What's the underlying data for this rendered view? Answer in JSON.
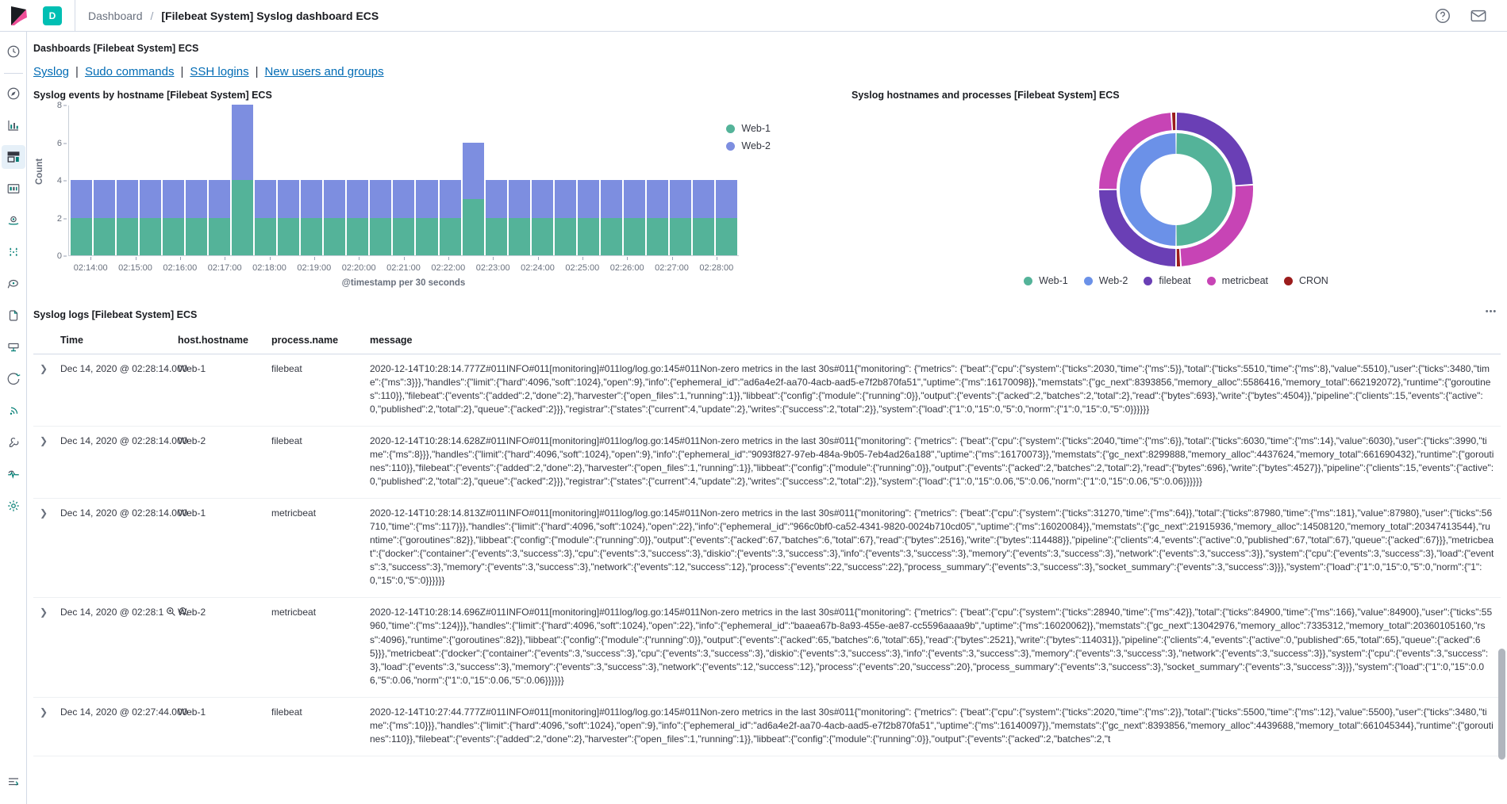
{
  "topbar": {
    "space_badge": "D",
    "breadcrumb_parent": "Dashboard",
    "breadcrumb_sep": "/",
    "breadcrumb_current": "[Filebeat System] Syslog dashboard ECS",
    "help_icon": "help-circle-icon",
    "mail_icon": "mail-icon",
    "logo_icon": "kibana-logo-icon"
  },
  "rail": {
    "items": [
      {
        "name": "recently-viewed",
        "icon": "clock-icon",
        "selected": false
      },
      {
        "name": "discover",
        "icon": "compass-icon",
        "selected": false
      },
      {
        "name": "visualize",
        "icon": "bar-chart-icon",
        "selected": false
      },
      {
        "name": "dashboard",
        "icon": "dashboard-icon",
        "selected": true
      },
      {
        "name": "canvas",
        "icon": "canvas-icon",
        "selected": false
      },
      {
        "name": "maps",
        "icon": "map-marker-icon",
        "selected": false
      },
      {
        "name": "machine-learning",
        "icon": "ml-nodes-icon",
        "selected": false
      },
      {
        "name": "infrastructure",
        "icon": "metrics-icon",
        "selected": false
      },
      {
        "name": "logs",
        "icon": "logs-icon",
        "selected": false
      },
      {
        "name": "apm",
        "icon": "apm-icon",
        "selected": false
      },
      {
        "name": "uptime",
        "icon": "uptime-icon",
        "selected": false
      },
      {
        "name": "siem",
        "icon": "security-icon",
        "selected": false
      },
      {
        "name": "dev-tools",
        "icon": "wrench-icon",
        "selected": false
      },
      {
        "name": "monitoring",
        "icon": "heartbeat-icon",
        "selected": false
      },
      {
        "name": "management",
        "icon": "gear-icon",
        "selected": false
      }
    ],
    "bottom_icon": "collapse-icon"
  },
  "dashboard": {
    "header": "Dashboards [Filebeat System] ECS",
    "nav_links": [
      "Syslog",
      "Sudo commands",
      "SSH logins",
      "New users and groups"
    ],
    "nav_separator": "|"
  },
  "chart_data": [
    {
      "type": "bar",
      "title": "Syslog events by hostname [Filebeat System] ECS",
      "stacked": true,
      "xlabel": "@timestamp per 30 seconds",
      "ylabel": "Count",
      "ylim": [
        0,
        8
      ],
      "yticks": [
        0,
        2,
        4,
        6,
        8
      ],
      "xticks": [
        "02:14:00",
        "02:15:00",
        "02:16:00",
        "02:17:00",
        "02:18:00",
        "02:19:00",
        "02:20:00",
        "02:21:00",
        "02:22:00",
        "02:23:00",
        "02:24:00",
        "02:25:00",
        "02:26:00",
        "02:27:00",
        "02:28:00"
      ],
      "grid": false,
      "legend_position": "right",
      "series": [
        {
          "name": "Web-1",
          "color": "#54b399",
          "values": [
            2,
            2,
            2,
            2,
            2,
            2,
            2,
            4,
            2,
            2,
            2,
            2,
            2,
            2,
            2,
            2,
            2,
            3,
            2,
            2,
            2,
            2,
            2,
            2,
            2,
            2,
            2,
            2,
            2
          ]
        },
        {
          "name": "Web-2",
          "color": "#7d8ee0",
          "values": [
            2,
            2,
            2,
            2,
            2,
            2,
            2,
            4,
            2,
            2,
            2,
            2,
            2,
            2,
            2,
            2,
            2,
            3,
            2,
            2,
            2,
            2,
            2,
            2,
            2,
            2,
            2,
            2,
            2
          ]
        }
      ]
    },
    {
      "type": "pie",
      "title": "Syslog hostnames and processes [Filebeat System] ECS",
      "legend_position": "bottom",
      "rings": [
        {
          "name": "hostname",
          "slices": [
            {
              "label": "Web-1",
              "value": 50,
              "color": "#54b399"
            },
            {
              "label": "Web-2",
              "value": 50,
              "color": "#6b91e8"
            }
          ]
        },
        {
          "name": "process",
          "slices": [
            {
              "label": "filebeat",
              "value": 24,
              "color": "#6a3fb5"
            },
            {
              "label": "metricbeat",
              "value": 25,
              "color": "#c744b5"
            },
            {
              "label": "CRON",
              "value": 1,
              "color": "#9b1c1c"
            },
            {
              "label": "filebeat",
              "value": 25,
              "color": "#6a3fb5"
            },
            {
              "label": "metricbeat",
              "value": 24,
              "color": "#c744b5"
            },
            {
              "label": "CRON",
              "value": 1,
              "color": "#9b1c1c"
            }
          ]
        }
      ],
      "legend": [
        {
          "label": "Web-1",
          "color": "#54b399"
        },
        {
          "label": "Web-2",
          "color": "#6b91e8"
        },
        {
          "label": "filebeat",
          "color": "#6a3fb5"
        },
        {
          "label": "metricbeat",
          "color": "#c744b5"
        },
        {
          "label": "CRON",
          "color": "#9b1c1c"
        }
      ]
    }
  ],
  "logs_panel": {
    "title": "Syslog logs [Filebeat System] ECS",
    "menu_icon": "panel-options-icon",
    "columns": [
      "Time",
      "host.hostname",
      "process.name",
      "message"
    ],
    "rows": [
      {
        "time": "Dec 14, 2020 @ 02:28:14.000",
        "host": "Web-1",
        "process": "filebeat",
        "message": "2020-12-14T10:28:14.777Z#011INFO#011[monitoring]#011log/log.go:145#011Non-zero metrics in the last 30s#011{\"monitoring\": {\"metrics\": {\"beat\":{\"cpu\":{\"system\":{\"ticks\":2030,\"time\":{\"ms\":5}},\"total\":{\"ticks\":5510,\"time\":{\"ms\":8},\"value\":5510},\"user\":{\"ticks\":3480,\"time\":{\"ms\":3}}},\"handles\":{\"limit\":{\"hard\":4096,\"soft\":1024},\"open\":9},\"info\":{\"ephemeral_id\":\"ad6a4e2f-aa70-4acb-aad5-e7f2b870fa51\",\"uptime\":{\"ms\":16170098}},\"memstats\":{\"gc_next\":8393856,\"memory_alloc\":5586416,\"memory_total\":662192072},\"runtime\":{\"goroutines\":110}},\"filebeat\":{\"events\":{\"added\":2,\"done\":2},\"harvester\":{\"open_files\":1,\"running\":1}},\"libbeat\":{\"config\":{\"module\":{\"running\":0}},\"output\":{\"events\":{\"acked\":2,\"batches\":2,\"total\":2},\"read\":{\"bytes\":693},\"write\":{\"bytes\":4504}},\"pipeline\":{\"clients\":15,\"events\":{\"active\":0,\"published\":2,\"total\":2},\"queue\":{\"acked\":2}}},\"registrar\":{\"states\":{\"current\":4,\"update\":2},\"writes\":{\"success\":2,\"total\":2}},\"system\":{\"load\":{\"1\":0,\"15\":0,\"5\":0,\"norm\":{\"1\":0,\"15\":0,\"5\":0}}}}}}",
        "has_filter_icons": false
      },
      {
        "time": "Dec 14, 2020 @ 02:28:14.000",
        "host": "Web-2",
        "process": "filebeat",
        "message": "2020-12-14T10:28:14.628Z#011INFO#011[monitoring]#011log/log.go:145#011Non-zero metrics in the last 30s#011{\"monitoring\": {\"metrics\": {\"beat\":{\"cpu\":{\"system\":{\"ticks\":2040,\"time\":{\"ms\":6}},\"total\":{\"ticks\":6030,\"time\":{\"ms\":14},\"value\":6030},\"user\":{\"ticks\":3990,\"time\":{\"ms\":8}}},\"handles\":{\"limit\":{\"hard\":4096,\"soft\":1024},\"open\":9},\"info\":{\"ephemeral_id\":\"9093f827-97eb-484a-9b05-7eb4ad26a188\",\"uptime\":{\"ms\":16170073}},\"memstats\":{\"gc_next\":8299888,\"memory_alloc\":4437624,\"memory_total\":661690432},\"runtime\":{\"goroutines\":110}},\"filebeat\":{\"events\":{\"added\":2,\"done\":2},\"harvester\":{\"open_files\":1,\"running\":1}},\"libbeat\":{\"config\":{\"module\":{\"running\":0}},\"output\":{\"events\":{\"acked\":2,\"batches\":2,\"total\":2},\"read\":{\"bytes\":696},\"write\":{\"bytes\":4527}},\"pipeline\":{\"clients\":15,\"events\":{\"active\":0,\"published\":2,\"total\":2},\"queue\":{\"acked\":2}}},\"registrar\":{\"states\":{\"current\":4,\"update\":2},\"writes\":{\"success\":2,\"total\":2}},\"system\":{\"load\":{\"1\":0,\"15\":0.06,\"5\":0.06,\"norm\":{\"1\":0,\"15\":0.06,\"5\":0.06}}}}}}",
        "has_filter_icons": false
      },
      {
        "time": "Dec 14, 2020 @ 02:28:14.000",
        "host": "Web-1",
        "process": "metricbeat",
        "message": "2020-12-14T10:28:14.813Z#011INFO#011[monitoring]#011log/log.go:145#011Non-zero metrics in the last 30s#011{\"monitoring\": {\"metrics\": {\"beat\":{\"cpu\":{\"system\":{\"ticks\":31270,\"time\":{\"ms\":64}},\"total\":{\"ticks\":87980,\"time\":{\"ms\":181},\"value\":87980},\"user\":{\"ticks\":56710,\"time\":{\"ms\":117}}},\"handles\":{\"limit\":{\"hard\":4096,\"soft\":1024},\"open\":22},\"info\":{\"ephemeral_id\":\"966c0bf0-ca52-4341-9820-0024b710cd05\",\"uptime\":{\"ms\":16020084}},\"memstats\":{\"gc_next\":21915936,\"memory_alloc\":14508120,\"memory_total\":20347413544},\"runtime\":{\"goroutines\":82}},\"libbeat\":{\"config\":{\"module\":{\"running\":0}},\"output\":{\"events\":{\"acked\":67,\"batches\":6,\"total\":67},\"read\":{\"bytes\":2516},\"write\":{\"bytes\":114488}},\"pipeline\":{\"clients\":4,\"events\":{\"active\":0,\"published\":67,\"total\":67},\"queue\":{\"acked\":67}}},\"metricbeat\":{\"docker\":{\"container\":{\"events\":3,\"success\":3},\"cpu\":{\"events\":3,\"success\":3},\"diskio\":{\"events\":3,\"success\":3},\"info\":{\"events\":3,\"success\":3},\"memory\":{\"events\":3,\"success\":3},\"network\":{\"events\":3,\"success\":3}},\"system\":{\"cpu\":{\"events\":3,\"success\":3},\"load\":{\"events\":3,\"success\":3},\"memory\":{\"events\":3,\"success\":3},\"network\":{\"events\":12,\"success\":12},\"process\":{\"events\":22,\"success\":22},\"process_summary\":{\"events\":3,\"success\":3},\"socket_summary\":{\"events\":3,\"success\":3}}},\"system\":{\"load\":{\"1\":0,\"15\":0,\"5\":0,\"norm\":{\"1\":0,\"15\":0,\"5\":0}}}}}}",
        "has_filter_icons": false
      },
      {
        "time": "Dec 14, 2020 @ 02:28:1",
        "host": "Web-2",
        "process": "metricbeat",
        "message": "2020-12-14T10:28:14.696Z#011INFO#011[monitoring]#011log/log.go:145#011Non-zero metrics in the last 30s#011{\"monitoring\": {\"metrics\": {\"beat\":{\"cpu\":{\"system\":{\"ticks\":28940,\"time\":{\"ms\":42}},\"total\":{\"ticks\":84900,\"time\":{\"ms\":166},\"value\":84900},\"user\":{\"ticks\":55960,\"time\":{\"ms\":124}}},\"handles\":{\"limit\":{\"hard\":4096,\"soft\":1024},\"open\":22},\"info\":{\"ephemeral_id\":\"baaea67b-8a93-455e-ae87-cc5596aaaa9b\",\"uptime\":{\"ms\":16020062}},\"memstats\":{\"gc_next\":13042976,\"memory_alloc\":7335312,\"memory_total\":20360105160,\"rss\":4096},\"runtime\":{\"goroutines\":82}},\"libbeat\":{\"config\":{\"module\":{\"running\":0}},\"output\":{\"events\":{\"acked\":65,\"batches\":6,\"total\":65},\"read\":{\"bytes\":2521},\"write\":{\"bytes\":114031}},\"pipeline\":{\"clients\":4,\"events\":{\"active\":0,\"published\":65,\"total\":65},\"queue\":{\"acked\":65}}},\"metricbeat\":{\"docker\":{\"container\":{\"events\":3,\"success\":3},\"cpu\":{\"events\":3,\"success\":3},\"diskio\":{\"events\":3,\"success\":3},\"info\":{\"events\":3,\"success\":3},\"memory\":{\"events\":3,\"success\":3},\"network\":{\"events\":3,\"success\":3}},\"system\":{\"cpu\":{\"events\":3,\"success\":3},\"load\":{\"events\":3,\"success\":3},\"memory\":{\"events\":3,\"success\":3},\"network\":{\"events\":12,\"success\":12},\"process\":{\"events\":20,\"success\":20},\"process_summary\":{\"events\":3,\"success\":3},\"socket_summary\":{\"events\":3,\"success\":3}}},\"system\":{\"load\":{\"1\":0,\"15\":0.06,\"5\":0.06,\"norm\":{\"1\":0,\"15\":0.06,\"5\":0.06}}}}}}",
        "has_filter_icons": true,
        "filter_in_icon": "magnify-plus-icon",
        "filter_out_icon": "magnify-minus-icon"
      },
      {
        "time": "Dec 14, 2020 @ 02:27:44.000",
        "host": "Web-1",
        "process": "filebeat",
        "message": "2020-12-14T10:27:44.777Z#011INFO#011[monitoring]#011log/log.go:145#011Non-zero metrics in the last 30s#011{\"monitoring\": {\"metrics\": {\"beat\":{\"cpu\":{\"system\":{\"ticks\":2020,\"time\":{\"ms\":2}},\"total\":{\"ticks\":5500,\"time\":{\"ms\":12},\"value\":5500},\"user\":{\"ticks\":3480,\"time\":{\"ms\":10}}},\"handles\":{\"limit\":{\"hard\":4096,\"soft\":1024},\"open\":9},\"info\":{\"ephemeral_id\":\"ad6a4e2f-aa70-4acb-aad5-e7f2b870fa51\",\"uptime\":{\"ms\":16140097}},\"memstats\":{\"gc_next\":8393856,\"memory_alloc\":4439688,\"memory_total\":661045344},\"runtime\":{\"goroutines\":110}},\"filebeat\":{\"events\":{\"added\":2,\"done\":2},\"harvester\":{\"open_files\":1,\"running\":1}},\"libbeat\":{\"config\":{\"module\":{\"running\":0}},\"output\":{\"events\":{\"acked\":2,\"batches\":2,\"t",
        "has_filter_icons": false
      }
    ]
  }
}
